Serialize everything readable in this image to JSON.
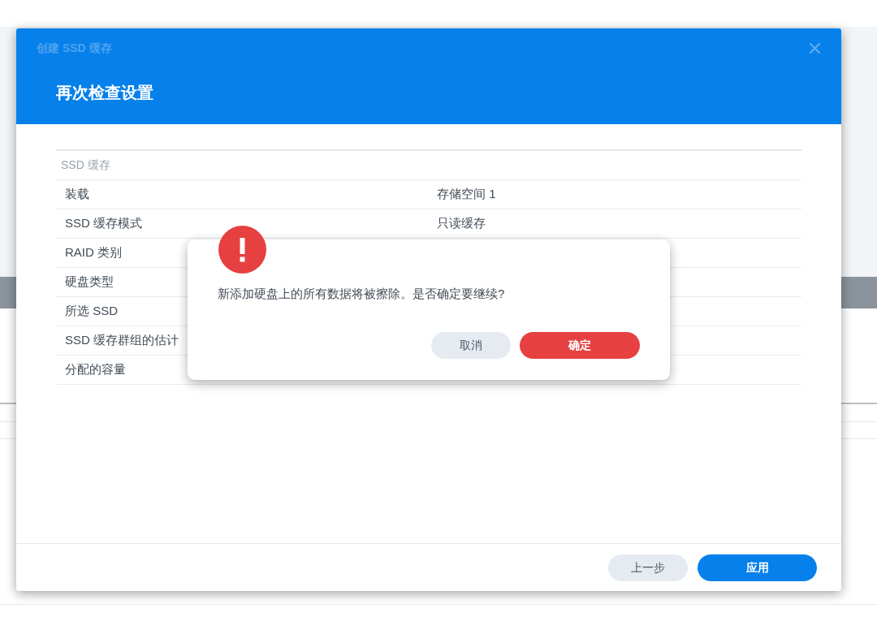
{
  "window": {
    "title": "创建 SSD 缓存",
    "heading": "再次检查设置"
  },
  "summary": {
    "section": "SSD 缓存",
    "rows": [
      {
        "label": "装载",
        "value": "存储空间 1"
      },
      {
        "label": "SSD 缓存模式",
        "value": "只读缓存"
      },
      {
        "label": "RAID 类别"
      },
      {
        "label": "硬盘类型"
      },
      {
        "label": "所选 SSD"
      },
      {
        "label": "SSD 缓存群组的估计"
      },
      {
        "label": "分配的容量"
      }
    ]
  },
  "footer_buttons": [
    {
      "label": "上一步",
      "kind": "secondary"
    },
    {
      "label": "应用",
      "kind": "primary"
    }
  ],
  "alert": {
    "message": "新添加硬盘上的所有数据将被擦除。是否确定要继续?",
    "buttons": [
      {
        "label": "取消",
        "kind": "secondary"
      },
      {
        "label": "确定",
        "kind": "danger"
      }
    ]
  }
}
